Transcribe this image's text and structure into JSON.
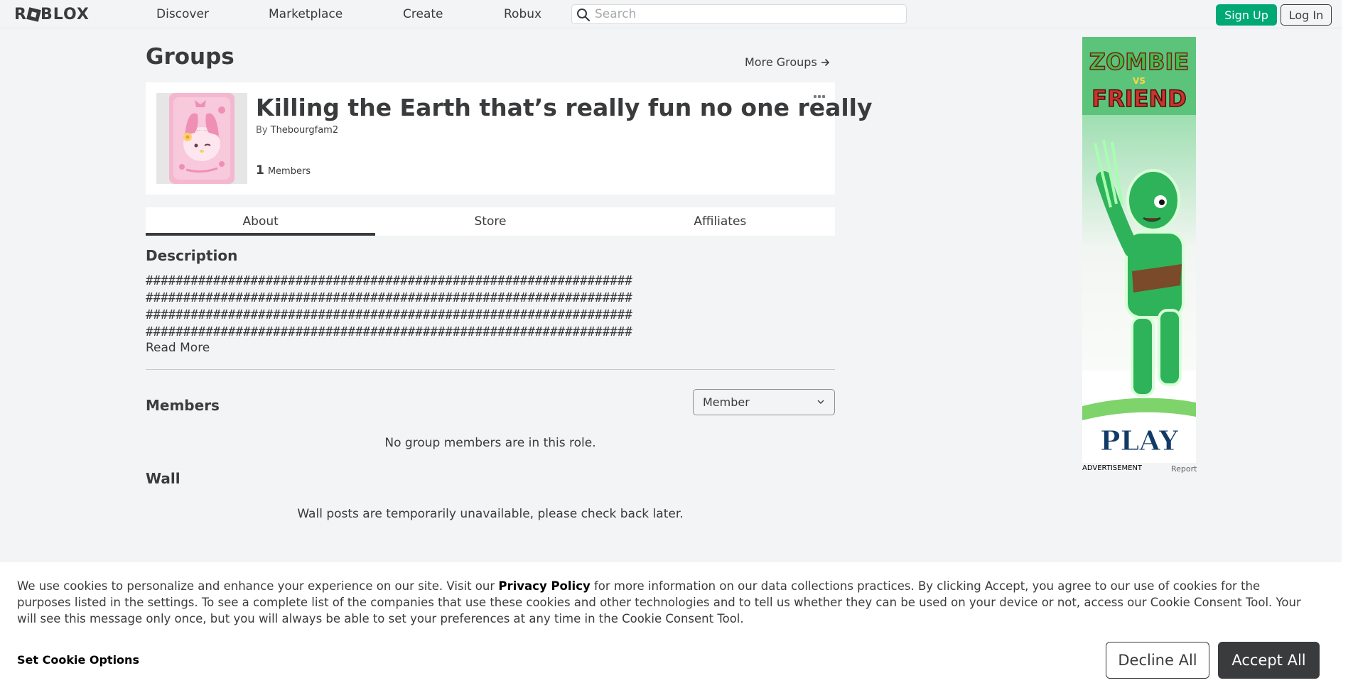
{
  "nav": {
    "logo_text": "ROBLOX",
    "links": [
      "Discover",
      "Marketplace",
      "Create",
      "Robux"
    ],
    "search_placeholder": "Search",
    "signup_label": "Sign Up",
    "login_label": "Log In"
  },
  "page": {
    "title": "Groups",
    "more_groups_label": "More Groups"
  },
  "group": {
    "name": "Killing the Earth that’s really fun no one really",
    "by_label": "By",
    "owner": "Thebourgfam2",
    "member_count": "1",
    "members_label": "Members"
  },
  "tabs": [
    "About",
    "Store",
    "Affiliates"
  ],
  "about": {
    "description_heading": "Description",
    "description_lines": [
      "#################################################################",
      "#################################################################",
      "#################################################################",
      "#################################################################"
    ],
    "read_more_label": "Read More",
    "members_heading": "Members",
    "role_selected": "Member",
    "no_members_msg": "No group members are in this role.",
    "wall_heading": "Wall",
    "wall_msg": "Wall posts are temporarily unavailable, please check back later."
  },
  "ad": {
    "title_top": "ZOMBIE",
    "title_vs": "VS",
    "title_bottom": "FRIEND",
    "cta": "PLAY",
    "label": "ADVERTISEMENT",
    "report_label": "Report"
  },
  "cookie": {
    "text_before": "We use cookies to personalize and enhance your experience on our site. Visit our ",
    "privacy_link": "Privacy Policy",
    "text_after": " for more information on our data collections practices. By clicking Accept, you agree to our use of cookies for the purposes listed in the settings. To see a complete list of the companies that use these cookies and other technologies and to tell us whether they can be used on your device or not, access our Cookie Consent Tool. Your will see this message only once, but you will always be able to set your preferences at any time in the Cookie Consent Tool.",
    "set_options_label": "Set Cookie Options",
    "decline_label": "Decline All",
    "accept_label": "Accept All"
  },
  "colors": {
    "accent_green": "#00a873",
    "text_dark": "#393b3d",
    "background": "#f2f4f5"
  }
}
